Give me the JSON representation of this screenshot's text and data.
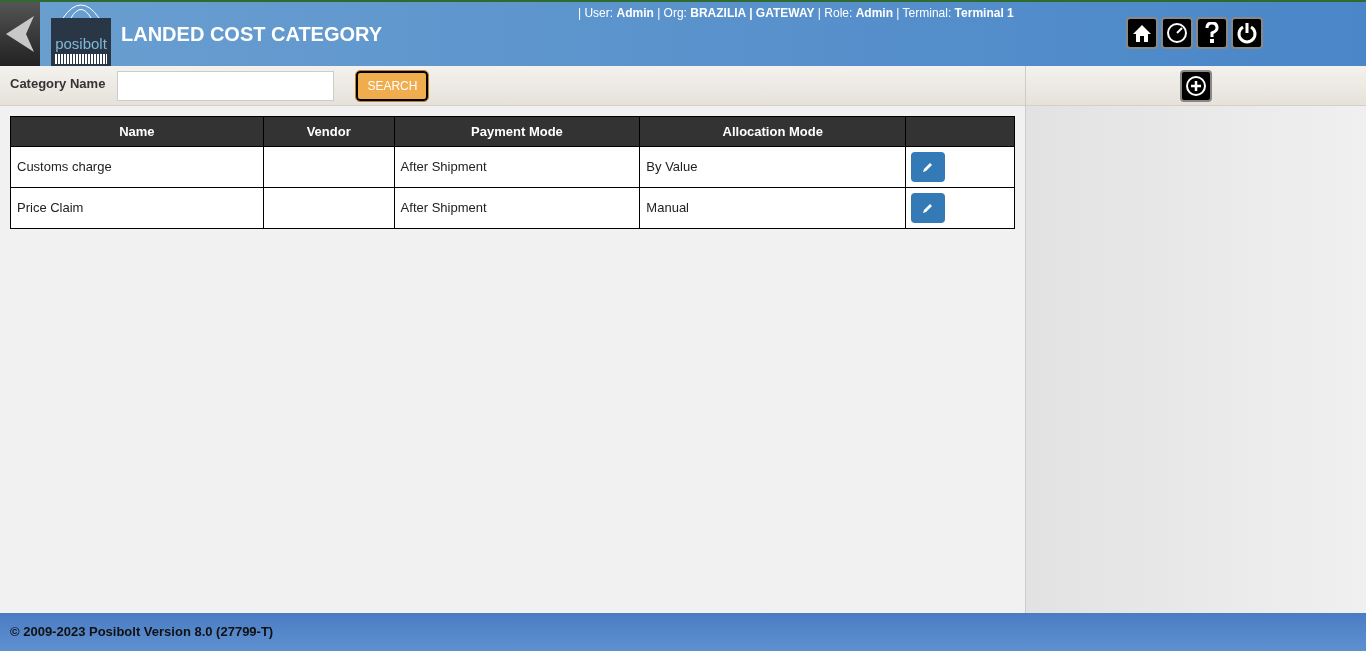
{
  "header": {
    "logo_text": "posibolt",
    "title": "LANDED COST CATEGORY",
    "session_info": "| User: **Admin** | Org: **BRAZILIA | GATEWAY** | Role: **Admin** | Terminal: **Terminal 1**"
  },
  "search": {
    "label": "Category Name",
    "button": "SEARCH"
  },
  "table": {
    "columns": [
      "Name",
      "Vendor",
      "Payment Mode",
      "Allocation Mode",
      ""
    ],
    "rows": [
      {
        "name": "Customs charge",
        "vendor": "",
        "payment_mode": "After Shipment",
        "allocation_mode": "By Value"
      },
      {
        "name": "Price Claim",
        "vendor": "",
        "payment_mode": "After Shipment",
        "allocation_mode": "Manual"
      }
    ]
  },
  "footer": "© 2009-2023 Posibolt Version 8.0 (27799-T)"
}
